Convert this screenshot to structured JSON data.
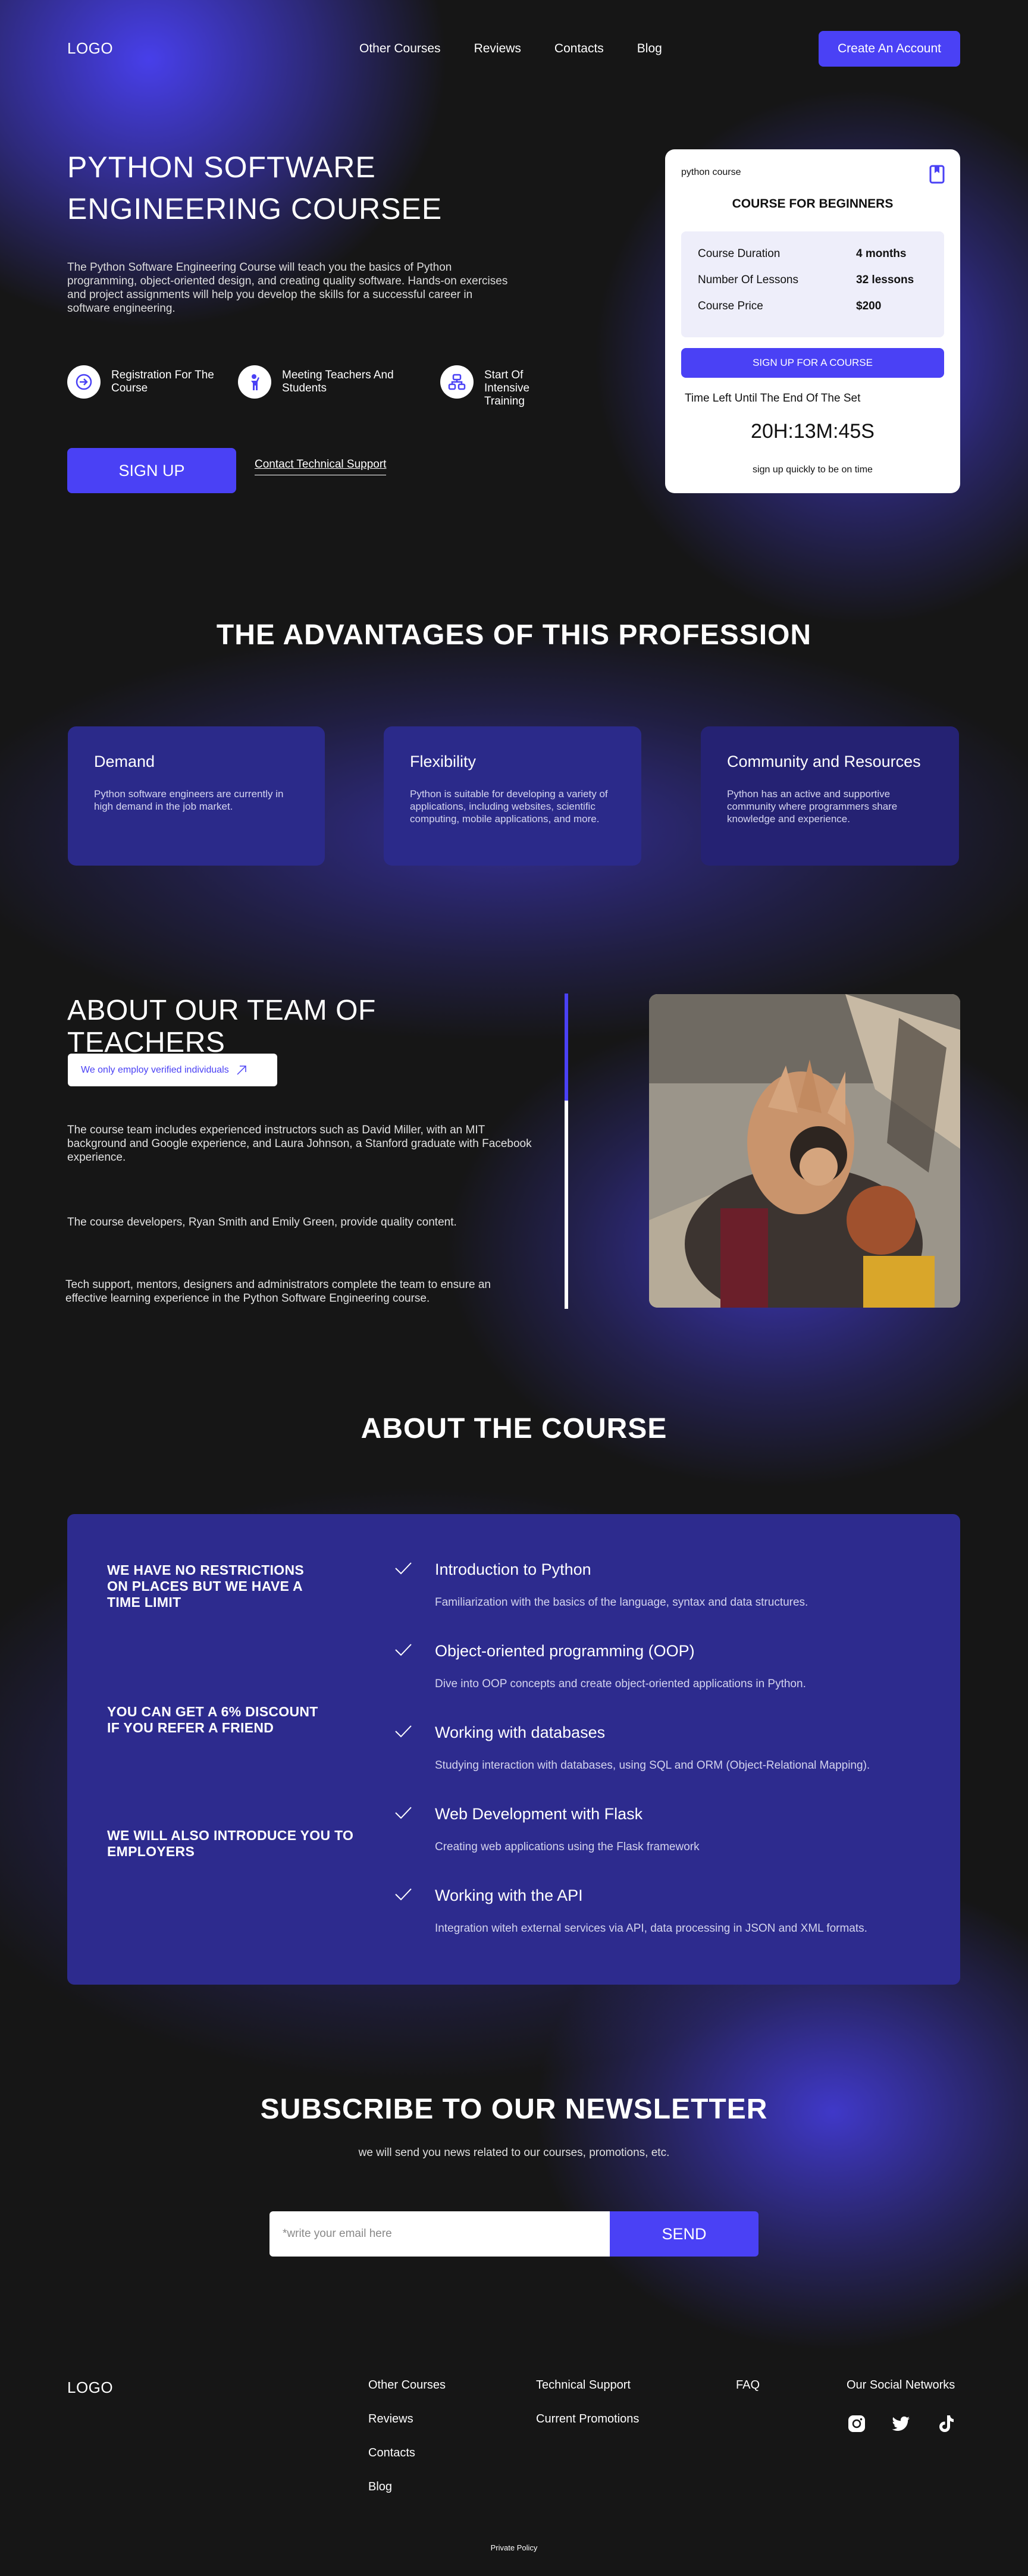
{
  "header": {
    "logo": "LOGO",
    "nav": [
      "Other Courses",
      "Reviews",
      "Contacts",
      "Blog"
    ],
    "cta": "Create An Account"
  },
  "hero": {
    "title_line1": "PYTHON SOFTWARE",
    "title_line2": "ENGINEERING COURSEE",
    "description": "The Python Software Engineering Course will teach you the basics of Python programming, object-oriented design, and creating quality software. Hands-on exercises and project assignments will help you develop the skills for a successful career in software engineering.",
    "features": [
      {
        "label": "Registration For The Course",
        "icon": "enter-icon"
      },
      {
        "label": "Meeting Teachers And Students",
        "icon": "teacher-icon"
      },
      {
        "label": "Start Of Intensive Training",
        "icon": "hierarchy-icon"
      }
    ],
    "signup": "SIGN UP",
    "support_link": "Contact Technical Support"
  },
  "course_card": {
    "tag": "python course",
    "heading": "COURSE FOR BEGINNERS",
    "stats": [
      {
        "label": "Course Duration",
        "value": "4 months"
      },
      {
        "label": "Number Of Lessons",
        "value": "32 lessons"
      },
      {
        "label": "Course Price",
        "value": "$200"
      }
    ],
    "button": "SIGN UP FOR A COURSE",
    "timer_label": "Time Left Until The End Of The Set",
    "timer": "20H:13M:45S",
    "note": "sign up quickly to be on time"
  },
  "advantages": {
    "title": "THE ADVANTAGES OF THIS PROFESSION",
    "cards": [
      {
        "title": "Demand",
        "text": "Python software engineers are currently in high demand in the job market."
      },
      {
        "title": "Flexibility",
        "text": "Python is suitable for developing a variety of applications, including websites, scientific computing, mobile applications, and more."
      },
      {
        "title": "Community and Resources",
        "text": "Python has an active and supportive community where programmers share knowledge and experience."
      }
    ]
  },
  "team": {
    "title_line1": "ABOUT OUR TEAM OF",
    "title_line2": "TEACHERS",
    "badge": "We only employ verified individuals",
    "paragraphs": [
      "The course team includes experienced instructors such as David Miller, with an MIT background and Google experience, and Laura Johnson, a Stanford graduate with Facebook experience.",
      "The course developers, Ryan Smith and Emily Green, provide quality content.",
      "Tech support, mentors, designers and administrators complete the team to ensure an effective learning experience in the Python Software Engineering course."
    ]
  },
  "about_course": {
    "title": "ABOUT THE COURSE",
    "perks": [
      "WE HAVE NO RESTRICTIONS ON PLACES BUT WE HAVE A TIME LIMIT",
      "YOU CAN GET A 6% DISCOUNT IF YOU REFER A FRIEND",
      "WE WILL ALSO INTRODUCE YOU TO EMPLOYERS"
    ],
    "topics": [
      {
        "title": "Introduction to Python",
        "desc": "Familiarization with the basics of the language, syntax and data structures."
      },
      {
        "title": "Object-oriented programming (OOP)",
        "desc": "Dive into OOP concepts and create object-oriented applications in Python."
      },
      {
        "title": "Working with databases",
        "desc": "Studying interaction with databases, using SQL and ORM (Object-Relational Mapping)."
      },
      {
        "title": "Web Development with Flask",
        "desc": "Creating web applications using the Flask framework"
      },
      {
        "title": "Working with the API",
        "desc": "Integration witeh external services via API, data processing in JSON and XML formats."
      }
    ]
  },
  "newsletter": {
    "title": "SUBSCRIBE TO OUR NEWSLETTER",
    "subtitle": "we will send you news related to our courses, promotions, etc.",
    "placeholder": "*write your email here",
    "button": "SEND"
  },
  "footer": {
    "logo": "LOGO",
    "col1": [
      "Other Courses",
      "Reviews",
      "Contacts",
      "Blog"
    ],
    "col2": [
      "Technical Support",
      "Current Promotions"
    ],
    "col3": [
      "FAQ"
    ],
    "social_title": "Our Social Networks",
    "socials": [
      "instagram-icon",
      "twitter-icon",
      "tiktok-icon"
    ],
    "policy": "Private Policy"
  },
  "colors": {
    "accent": "#4a41f5",
    "background": "#161616",
    "panel": "#2d2b8e"
  }
}
